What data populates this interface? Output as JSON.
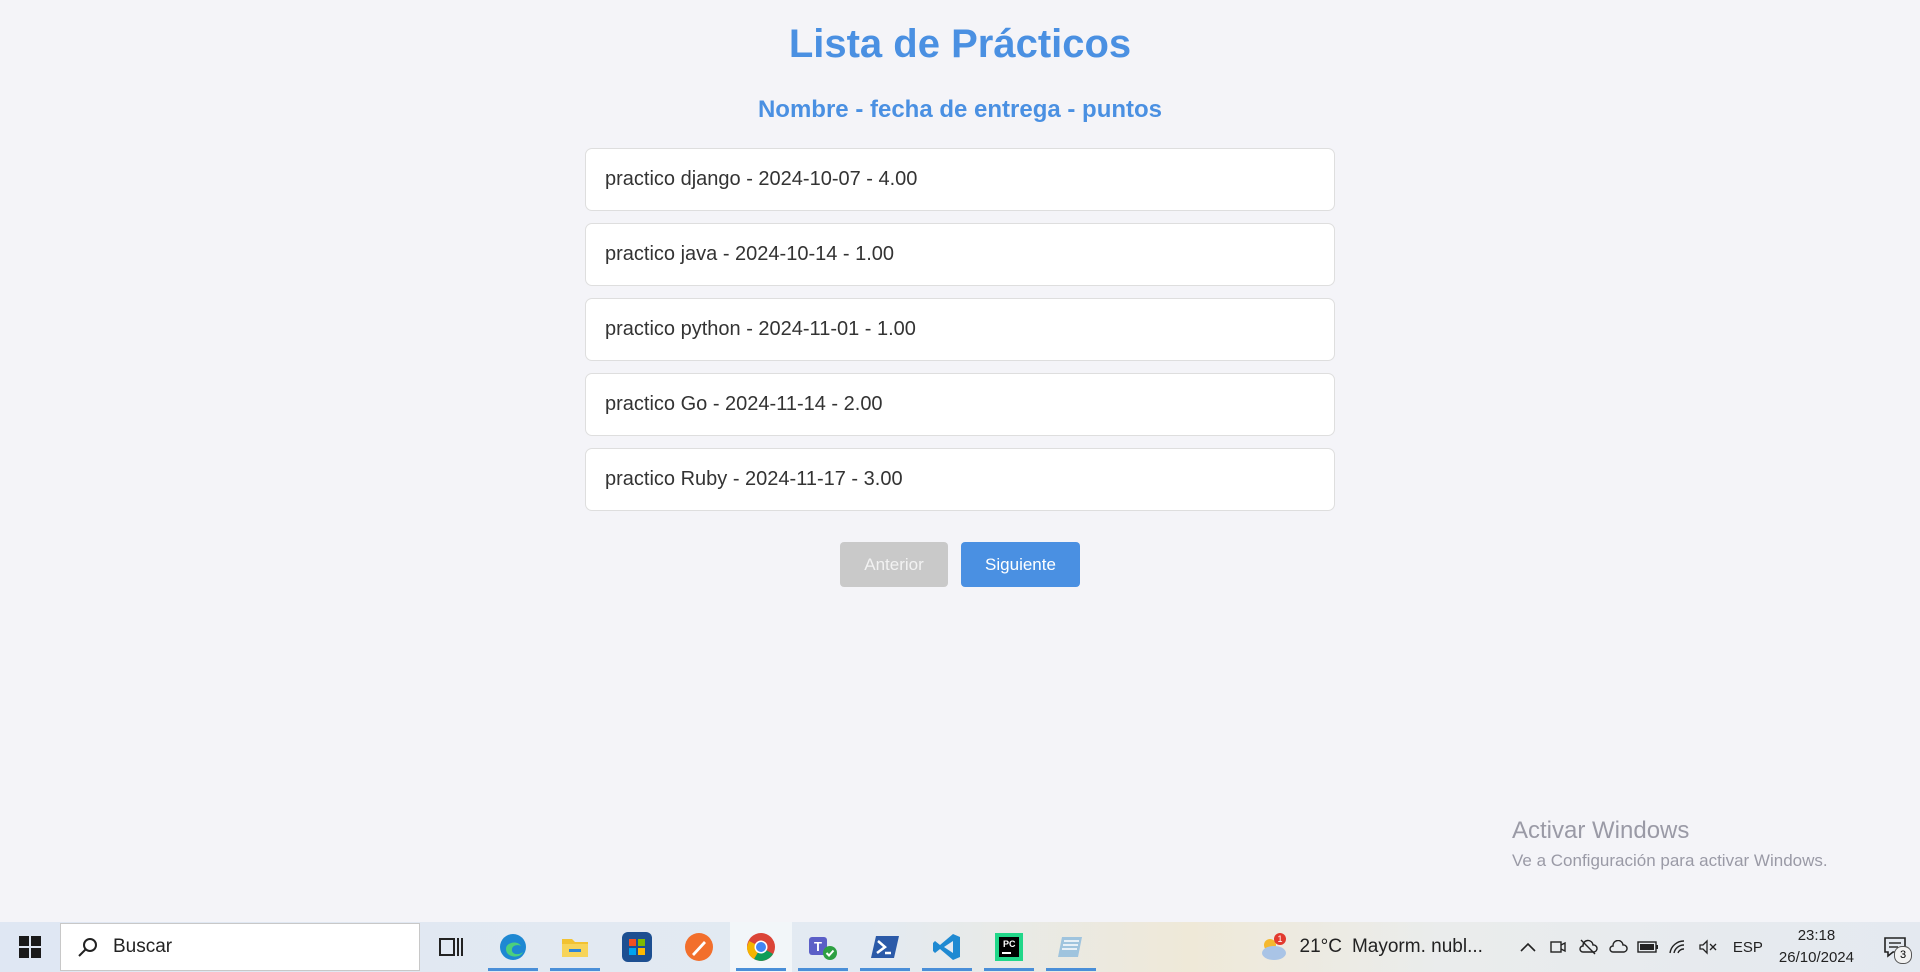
{
  "page": {
    "title": "Lista de Prácticos",
    "subtitle": "Nombre - fecha de entrega - puntos",
    "items": [
      {
        "text": "practico django - 2024-10-07 - 4.00"
      },
      {
        "text": "practico java - 2024-10-14 - 1.00"
      },
      {
        "text": "practico python - 2024-11-01 - 1.00"
      },
      {
        "text": "practico Go - 2024-11-14 - 2.00"
      },
      {
        "text": "practico Ruby - 2024-11-17 - 3.00"
      }
    ],
    "pagination": {
      "prev_label": "Anterior",
      "next_label": "Siguiente"
    }
  },
  "watermark": {
    "line1": "Activar Windows",
    "line2": "Ve a Configuración para activar Windows."
  },
  "taskbar": {
    "search_placeholder": "Buscar",
    "apps": [
      "task-view",
      "edge",
      "file-explorer",
      "microsoft-store",
      "swift-playgrounds",
      "chrome",
      "teams",
      "powershell",
      "vscode",
      "pycharm",
      "notepad"
    ],
    "weather": {
      "temperature": "21°C",
      "condition": "Mayorm. nubl...",
      "badge": "1"
    },
    "language": "ESP",
    "time": "23:18",
    "date": "26/10/2024",
    "notification_count": "3"
  },
  "colors": {
    "accent": "#4a90e2",
    "background": "#f4f4f8",
    "disabled_button": "#c9c9c9"
  }
}
